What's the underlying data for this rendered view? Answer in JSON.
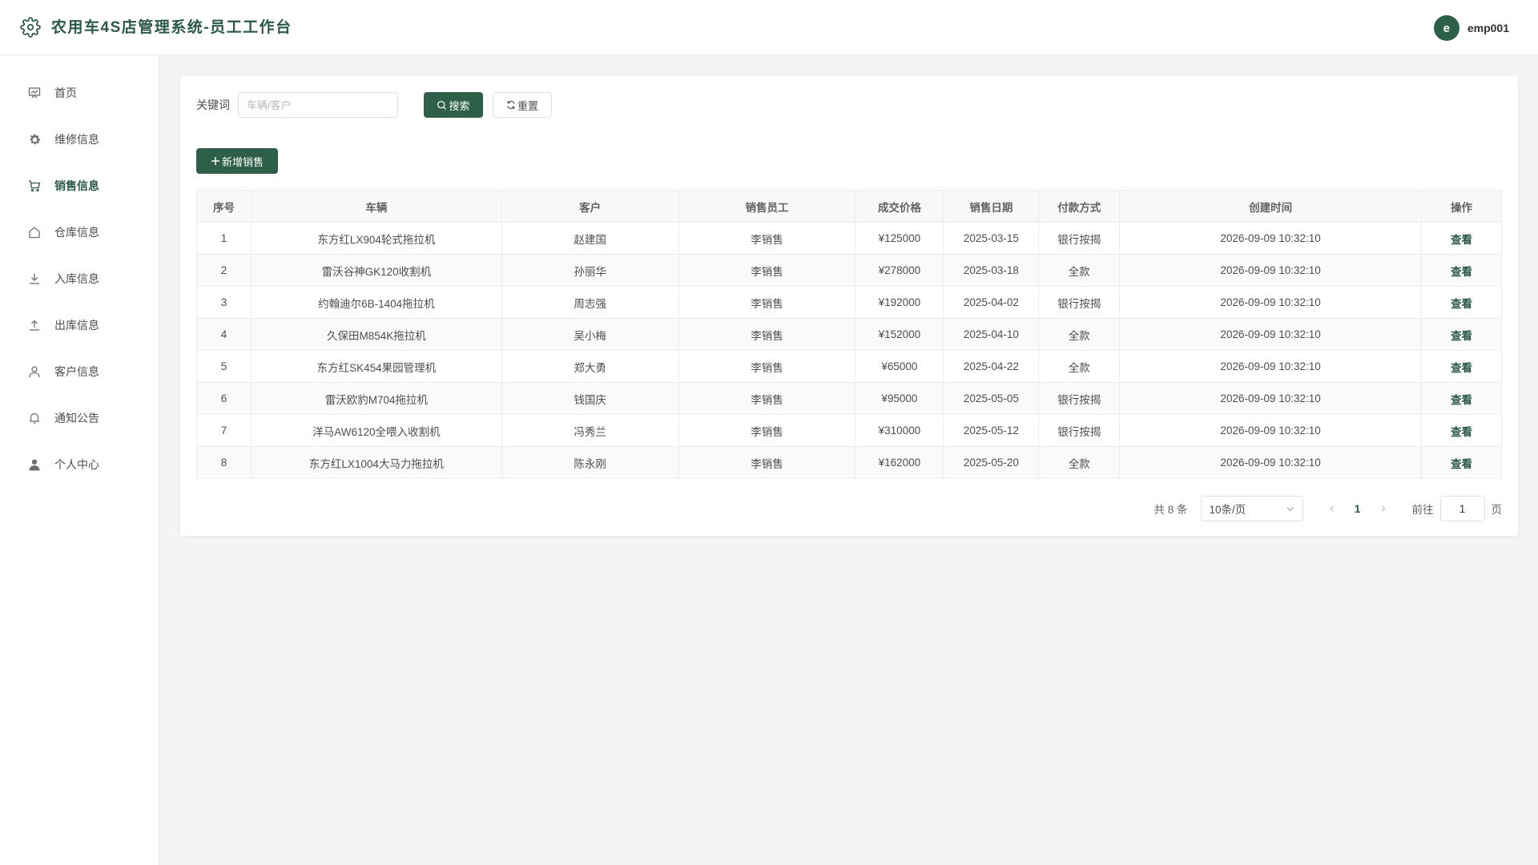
{
  "header": {
    "title": "农用车4S店管理系统-员工工作台",
    "avatar_letter": "e",
    "username": "emp001"
  },
  "sidebar": {
    "items": [
      {
        "label": "首页",
        "icon": "dashboard-icon"
      },
      {
        "label": "维修信息",
        "icon": "gear-icon"
      },
      {
        "label": "销售信息",
        "icon": "cart-icon",
        "active": true
      },
      {
        "label": "仓库信息",
        "icon": "house-icon"
      },
      {
        "label": "入库信息",
        "icon": "download-icon"
      },
      {
        "label": "出库信息",
        "icon": "upload-icon"
      },
      {
        "label": "客户信息",
        "icon": "user-icon"
      },
      {
        "label": "通知公告",
        "icon": "bell-icon"
      },
      {
        "label": "个人中心",
        "icon": "user-filled-icon"
      }
    ]
  },
  "search": {
    "label": "关键词",
    "placeholder": "车辆/客户",
    "value": "",
    "search_button": "搜索",
    "reset_button": "重置"
  },
  "toolbar": {
    "add_button": "新增销售"
  },
  "table": {
    "columns": [
      "序号",
      "车辆",
      "客户",
      "销售员工",
      "成交价格",
      "销售日期",
      "付款方式",
      "创建时间",
      "操作"
    ],
    "action_label": "查看",
    "rows": [
      [
        "1",
        "东方红LX904轮式拖拉机",
        "赵建国",
        "李销售",
        "¥125000",
        "2025-03-15",
        "银行按揭",
        "2026-09-09 10:32:10"
      ],
      [
        "2",
        "雷沃谷神GK120收割机",
        "孙丽华",
        "李销售",
        "¥278000",
        "2025-03-18",
        "全款",
        "2026-09-09 10:32:10"
      ],
      [
        "3",
        "约翰迪尔6B-1404拖拉机",
        "周志强",
        "李销售",
        "¥192000",
        "2025-04-02",
        "银行按揭",
        "2026-09-09 10:32:10"
      ],
      [
        "4",
        "久保田M854K拖拉机",
        "吴小梅",
        "李销售",
        "¥152000",
        "2025-04-10",
        "全款",
        "2026-09-09 10:32:10"
      ],
      [
        "5",
        "东方红SK454果园管理机",
        "郑大勇",
        "李销售",
        "¥65000",
        "2025-04-22",
        "全款",
        "2026-09-09 10:32:10"
      ],
      [
        "6",
        "雷沃欧豹M704拖拉机",
        "钱国庆",
        "李销售",
        "¥95000",
        "2025-05-05",
        "银行按揭",
        "2026-09-09 10:32:10"
      ],
      [
        "7",
        "洋马AW6120全喂入收割机",
        "冯秀兰",
        "李销售",
        "¥310000",
        "2025-05-12",
        "银行按揭",
        "2026-09-09 10:32:10"
      ],
      [
        "8",
        "东方红LX1004大马力拖拉机",
        "陈永刚",
        "李销售",
        "¥162000",
        "2025-05-20",
        "全款",
        "2026-09-09 10:32:10"
      ]
    ]
  },
  "pagination": {
    "total_text": "共 8 条",
    "page_size": "10条/页",
    "current_page": "1",
    "goto_label": "前往",
    "goto_value": "1",
    "page_suffix": "页"
  },
  "colors": {
    "brand": "#2d5f49",
    "title": "#2a5a45"
  }
}
